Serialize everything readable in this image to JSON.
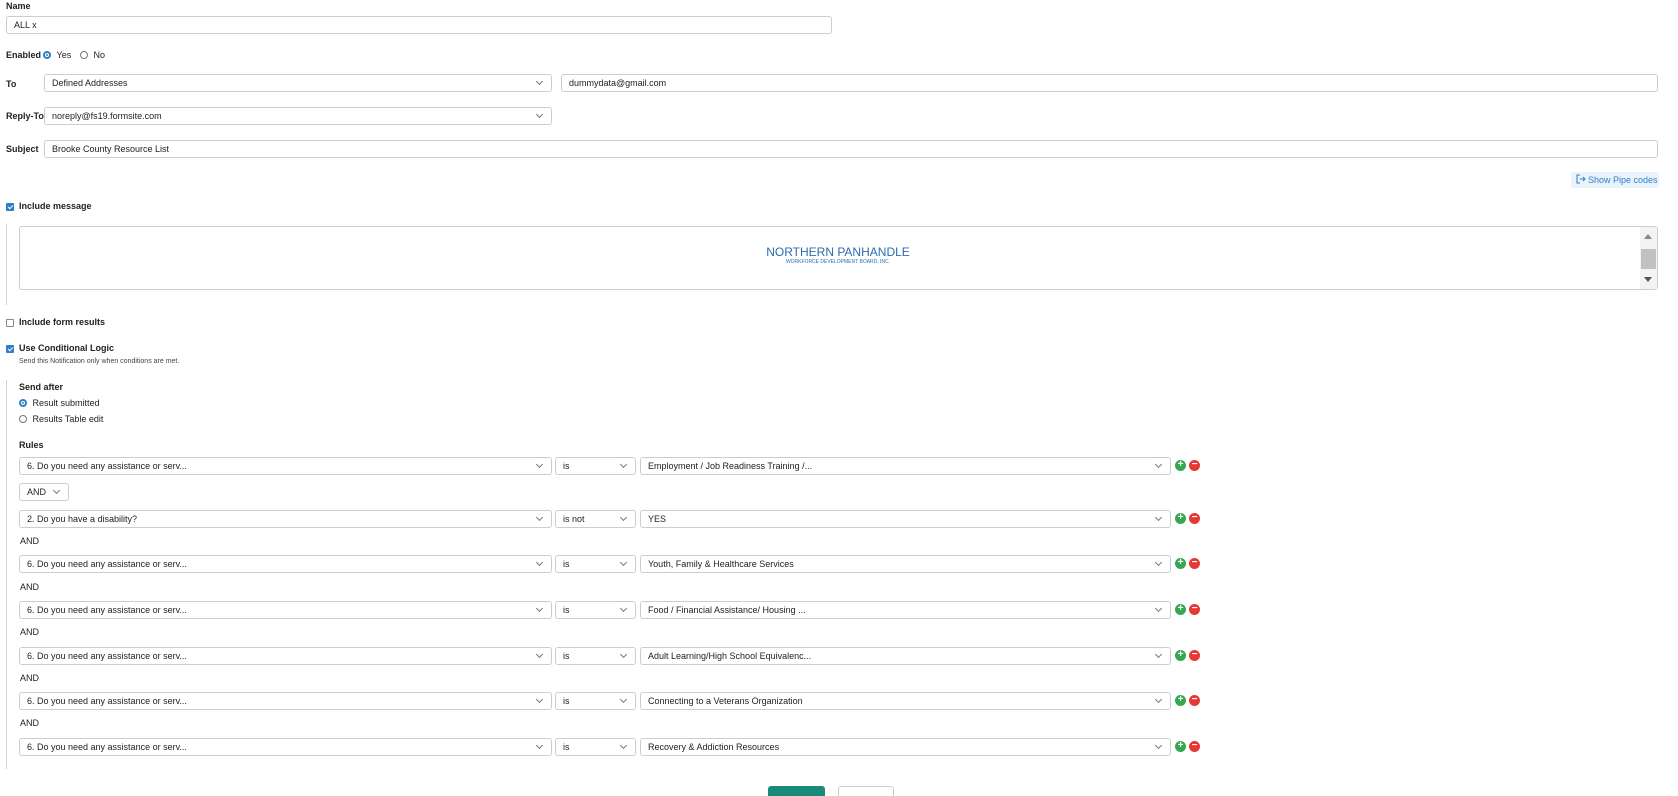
{
  "name": {
    "label": "Name",
    "value": "ALL x"
  },
  "enabled": {
    "label": "Enabled",
    "options": [
      "Yes",
      "No"
    ],
    "selected": "Yes"
  },
  "to": {
    "label": "To",
    "type": "Defined Addresses",
    "address": "dummydata@gmail.com"
  },
  "reply_to": {
    "label": "Reply-To",
    "value": "noreply@fs19.formsite.com"
  },
  "subject": {
    "label": "Subject",
    "value": "Brooke County Resource List"
  },
  "pipe_codes": {
    "label": "Show Pipe codes"
  },
  "include_message": {
    "label": "Include message",
    "checked": true,
    "logo_title": "NORTHERN PANHANDLE",
    "logo_subtitle": "WORKFORCE DEVELOPMENT BOARD, INC."
  },
  "include_form_results": {
    "label": "Include form results",
    "checked": false
  },
  "conditional": {
    "label": "Use Conditional Logic",
    "checked": true,
    "help": "Send this Notification only when conditions are met."
  },
  "send_after": {
    "label": "Send after",
    "options": [
      "Result submitted",
      "Results Table edit"
    ],
    "selected": "Result submitted"
  },
  "rules": {
    "label": "Rules",
    "join": "AND",
    "and_label": "AND",
    "items": [
      {
        "field": "6. Do you need any assistance or serv...",
        "op": "is",
        "value": "Employment / Job Readiness Training /..."
      },
      {
        "field": "2. Do you have a disability?",
        "op": "is not",
        "value": "YES"
      },
      {
        "field": "6. Do you need any assistance or serv...",
        "op": "is",
        "value": "Youth, Family & Healthcare Services"
      },
      {
        "field": "6. Do you need any assistance or serv...",
        "op": "is",
        "value": "Food / Financial Assistance/ Housing ..."
      },
      {
        "field": "6. Do you need any assistance or serv...",
        "op": "is",
        "value": "Adult Learning/High School Equivalenc..."
      },
      {
        "field": "6. Do you need any assistance or serv...",
        "op": "is",
        "value": "Connecting to a Veterans Organization"
      },
      {
        "field": "6. Do you need any assistance or serv...",
        "op": "is",
        "value": "Recovery & Addiction Resources"
      }
    ]
  },
  "colors": {
    "accent": "#2f7ec9",
    "add": "#34a853",
    "remove": "#e53935",
    "logo": "#2b6cb0"
  },
  "icons": {
    "add": "plus-circle-icon",
    "remove": "minus-circle-icon",
    "pipe": "export-icon"
  }
}
